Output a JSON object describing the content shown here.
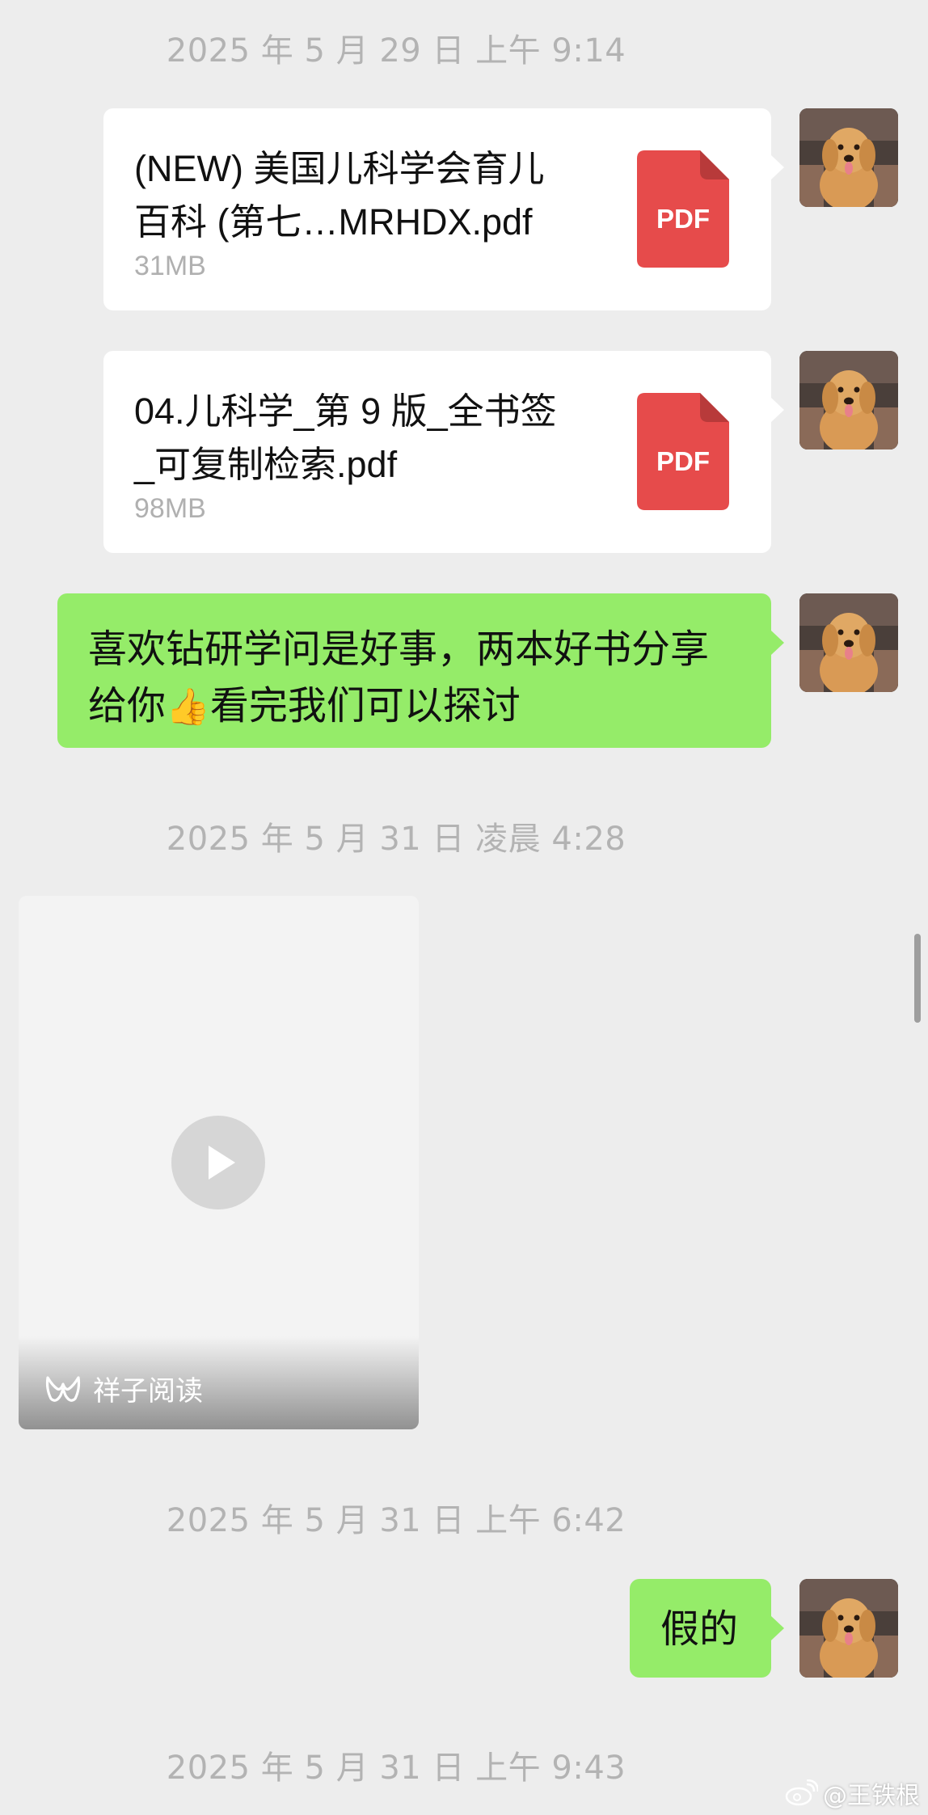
{
  "timestamps": [
    "2025 年 5 月 29 日 上午 9:14",
    "2025 年 5 月 31 日 凌晨 4:28",
    "2025 年 5 月 31 日 上午 6:42",
    "2025 年 5 月 31 日 上午 9:43"
  ],
  "files": [
    {
      "name_line1": "(NEW) 美国儿科学会育儿",
      "name_line2": "百科 (第七…MRHDX.pdf",
      "size": "31MB",
      "icon_label": "PDF"
    },
    {
      "name_line1": "04.儿科学_第 9 版_全书签",
      "name_line2": "_可复制检索.pdf",
      "size": "98MB",
      "icon_label": "PDF"
    }
  ],
  "messages": {
    "share_line1": "喜欢钻研学问是好事，两本好书分享",
    "share_line2_a": "给你",
    "share_emoji": "👍",
    "share_line2_b": "看完我们可以探讨",
    "reply": "假的"
  },
  "video": {
    "brand": "祥子阅读"
  },
  "watermark": "@王铁根",
  "icons": {
    "avatar": "golden-retriever-avatar",
    "file": "pdf-icon",
    "video": "play-icon",
    "brand": "xiangzi-logo-icon",
    "watermark": "weibo-icon"
  },
  "colors": {
    "background": "#ededed",
    "sent_bubble": "#95ec69",
    "file_card": "#ffffff",
    "pdf_red": "#e64b4b",
    "timestamp_text": "#b3b3b3"
  }
}
